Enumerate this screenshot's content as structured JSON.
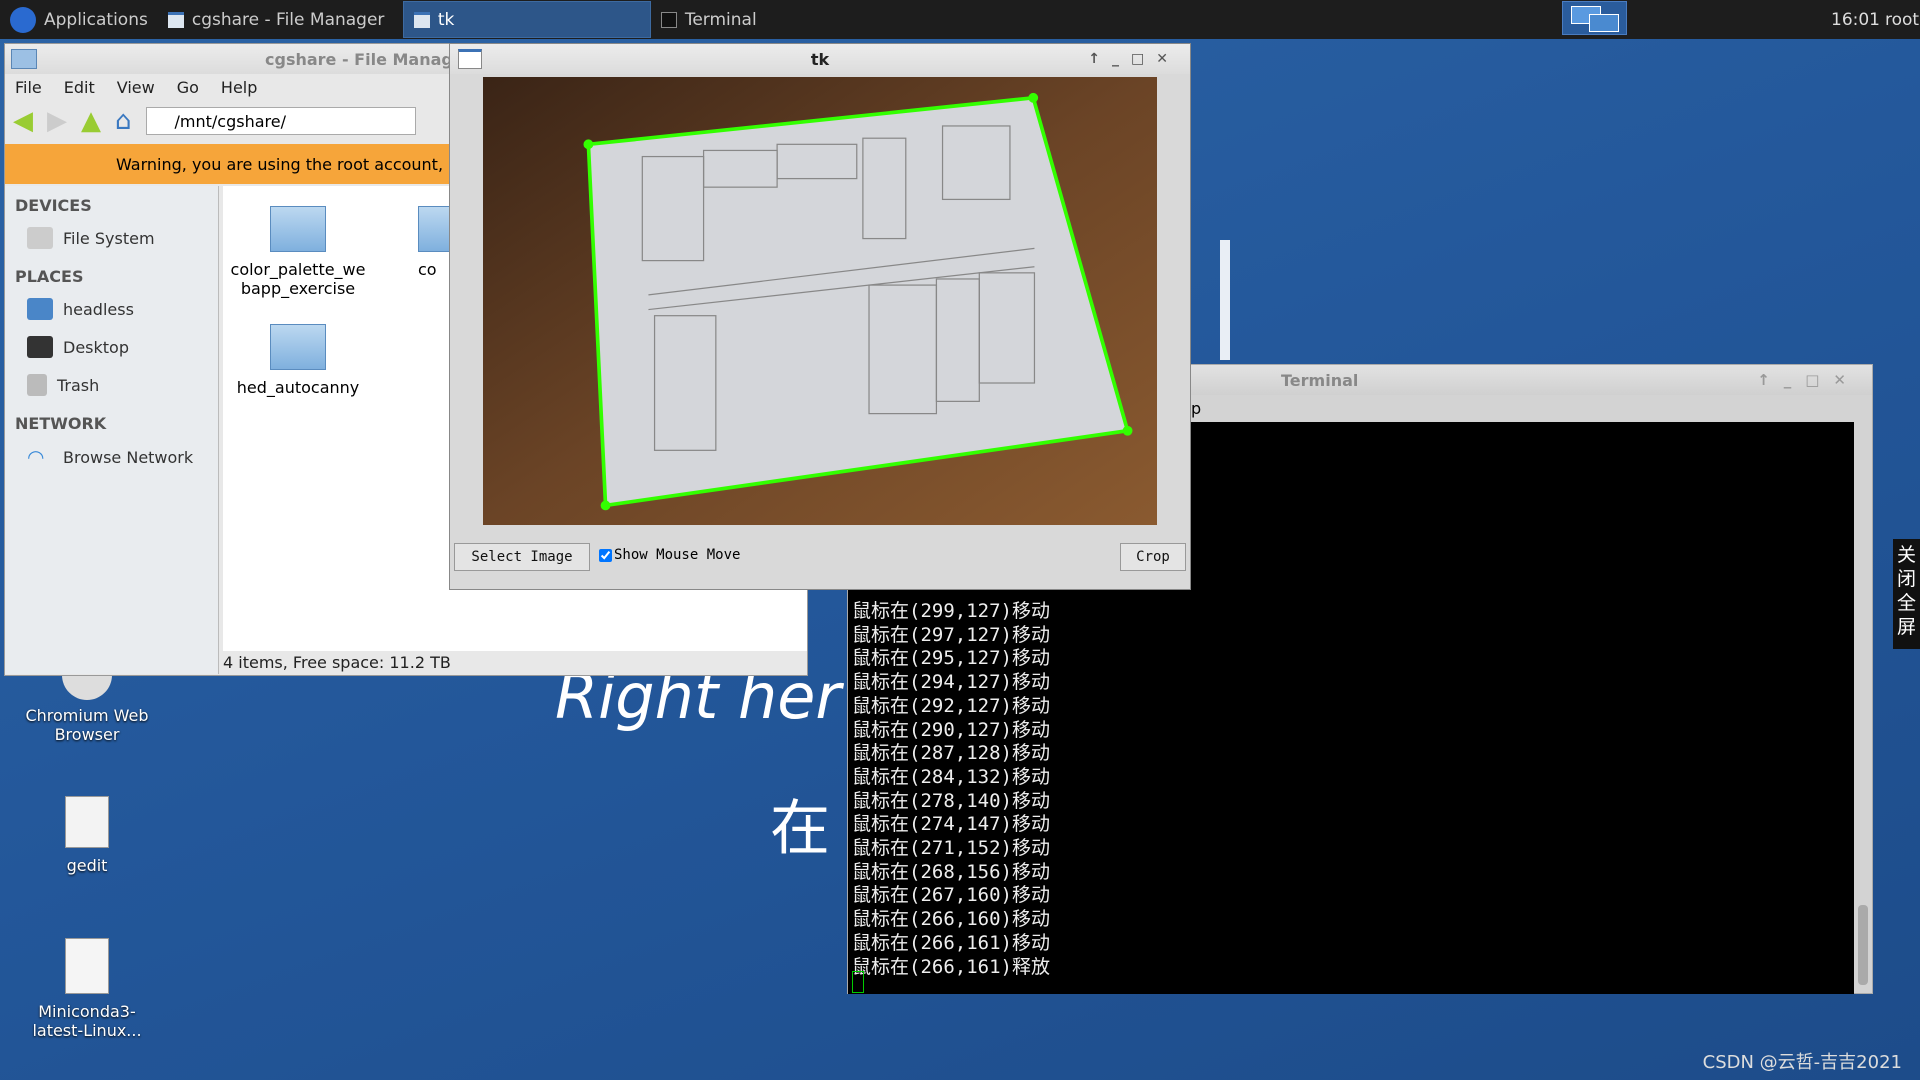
{
  "taskbar": {
    "applications": "Applications",
    "tasks": [
      {
        "label": "cgshare - File Manager"
      },
      {
        "label": "tk",
        "active": true
      },
      {
        "label": "Terminal"
      }
    ],
    "clock": "16:01",
    "user": "root"
  },
  "file_manager": {
    "title": "cgshare - File Manager",
    "menu": [
      "File",
      "Edit",
      "View",
      "Go",
      "Help"
    ],
    "path": "/mnt/cgshare/",
    "warning": "Warning, you are using the root account,",
    "sidebar": {
      "devices_heading": "DEVICES",
      "devices": [
        "File System"
      ],
      "places_heading": "PLACES",
      "places": [
        "headless",
        "Desktop",
        "Trash"
      ],
      "network_heading": "NETWORK",
      "network": [
        "Browse Network"
      ]
    },
    "files": [
      "color_palette_webapp_exercise",
      "co",
      "hed_autocanny"
    ],
    "status": "4 items, Free space: 11.2 TB"
  },
  "tk": {
    "title": "tk",
    "select_image": "Select Image",
    "show_mouse_move": "Show Mouse Move",
    "show_mouse_move_checked": true,
    "crop": "Crop",
    "accent": "#33ff00"
  },
  "terminal": {
    "title": "Terminal",
    "menu_fragment": "p",
    "lines": [
      "鼠标在(299,127)移动",
      "鼠标在(297,127)移动",
      "鼠标在(295,127)移动",
      "鼠标在(294,127)移动",
      "鼠标在(292,127)移动",
      "鼠标在(290,127)移动",
      "鼠标在(287,128)移动",
      "鼠标在(284,132)移动",
      "鼠标在(278,140)移动",
      "鼠标在(274,147)移动",
      "鼠标在(271,152)移动",
      "鼠标在(268,156)移动",
      "鼠标在(267,160)移动",
      "鼠标在(266,160)移动",
      "鼠标在(266,161)移动",
      "鼠标在(266,161)释放"
    ]
  },
  "desktop": {
    "icons": [
      "Chromium Web Browser",
      "gedit",
      "Miniconda3-latest-Linux..."
    ],
    "wallpaper_text_1": "Right her",
    "wallpaper_text_2": "在"
  },
  "side_panel": "关闭全屏",
  "watermark": "CSDN @云哲-吉吉2021"
}
